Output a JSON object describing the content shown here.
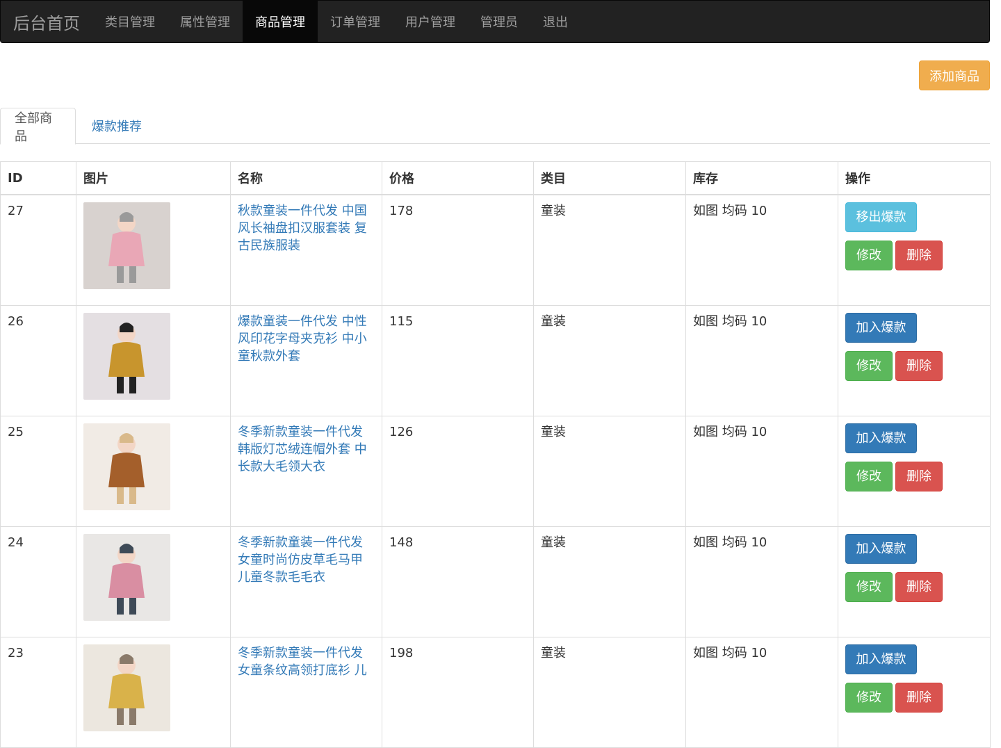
{
  "navbar": {
    "brand": "后台首页",
    "items": [
      {
        "label": "类目管理",
        "active": false
      },
      {
        "label": "属性管理",
        "active": false
      },
      {
        "label": "商品管理",
        "active": true
      },
      {
        "label": "订单管理",
        "active": false
      },
      {
        "label": "用户管理",
        "active": false
      },
      {
        "label": "管理员",
        "active": false
      },
      {
        "label": "退出",
        "active": false
      }
    ]
  },
  "toolbar": {
    "add_product_label": "添加商品"
  },
  "tabs": {
    "all": "全部商品",
    "hot": "爆款推荐"
  },
  "table": {
    "headers": {
      "id": "ID",
      "image": "图片",
      "name": "名称",
      "price": "价格",
      "category": "类目",
      "stock": "库存",
      "actions": "操作"
    },
    "rows": [
      {
        "id": "27",
        "name": "秋款童装一件代发 中国风长袖盘扣汉服套装 复古民族服装",
        "price": "178",
        "category": "童装",
        "stock": "如图 均码 10",
        "hot_label": "移出爆款",
        "is_hot": true,
        "edit_label": "修改",
        "delete_label": "删除",
        "thumb_colors": [
          "#d8d2cf",
          "#e9a7b6",
          "#9a9a9a"
        ]
      },
      {
        "id": "26",
        "name": "爆款童装一件代发 中性风印花字母夹克衫 中小童秋款外套",
        "price": "115",
        "category": "童装",
        "stock": "如图 均码 10",
        "hot_label": "加入爆款",
        "is_hot": false,
        "edit_label": "修改",
        "delete_label": "删除",
        "thumb_colors": [
          "#e4dfe2",
          "#c8952d",
          "#222222"
        ]
      },
      {
        "id": "25",
        "name": "冬季新款童装一件代发 韩版灯芯绒连帽外套 中长款大毛领大衣",
        "price": "126",
        "category": "童装",
        "stock": "如图 均码 10",
        "hot_label": "加入爆款",
        "is_hot": false,
        "edit_label": "修改",
        "delete_label": "删除",
        "thumb_colors": [
          "#f1ebe5",
          "#a45f2b",
          "#d9b98a"
        ]
      },
      {
        "id": "24",
        "name": "冬季新款童装一件代发 女童时尚仿皮草毛马甲 儿童冬款毛毛衣",
        "price": "148",
        "category": "童装",
        "stock": "如图 均码 10",
        "hot_label": "加入爆款",
        "is_hot": false,
        "edit_label": "修改",
        "delete_label": "删除",
        "thumb_colors": [
          "#e9e7e5",
          "#d98ea2",
          "#3e4a57"
        ]
      },
      {
        "id": "23",
        "name": "冬季新款童装一件代发 女童条纹高领打底衫 儿",
        "price": "198",
        "category": "童装",
        "stock": "如图 均码 10",
        "hot_label": "加入爆款",
        "is_hot": false,
        "edit_label": "修改",
        "delete_label": "删除",
        "thumb_colors": [
          "#ece7df",
          "#d9b24a",
          "#8a7a6a"
        ]
      }
    ]
  }
}
